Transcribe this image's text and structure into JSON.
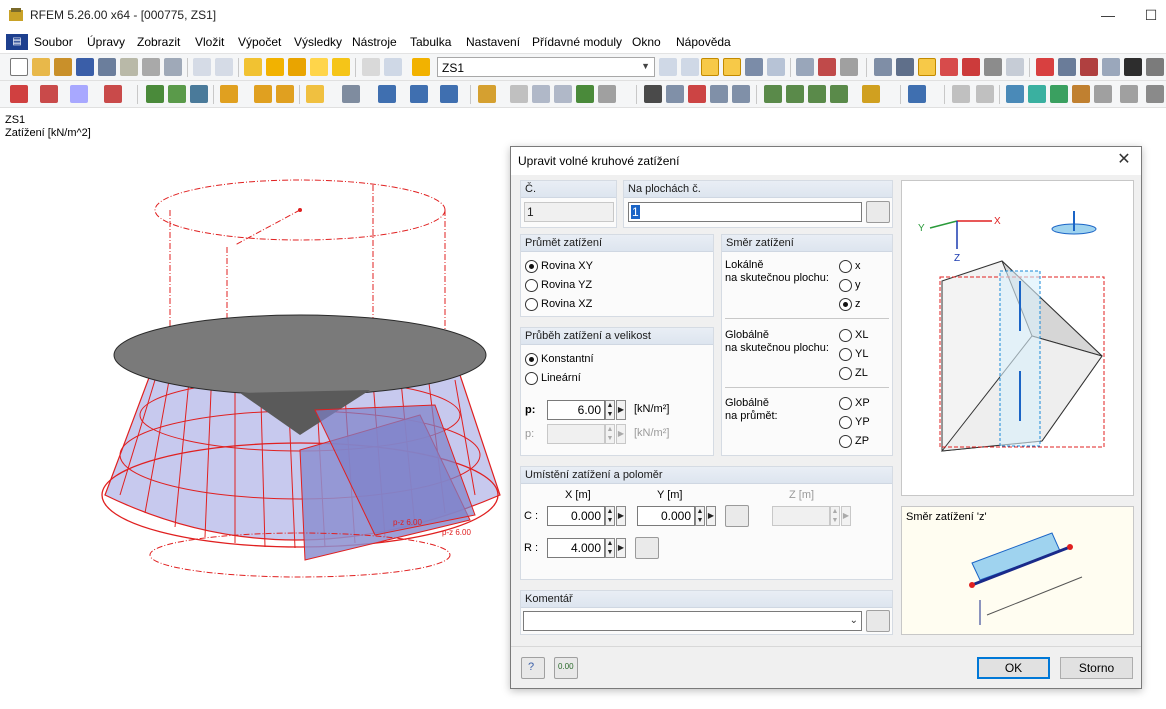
{
  "window": {
    "title": "RFEM 5.26.00 x64 - [000775, ZS1]",
    "min_glyph": "—",
    "max_glyph": "☐"
  },
  "menu": {
    "items": [
      "Soubor",
      "Úpravy",
      "Zobrazit",
      "Vložit",
      "Výpočet",
      "Výsledky",
      "Nástroje",
      "Tabulka",
      "Nastavení",
      "Přídavné moduly",
      "Okno",
      "Nápověda"
    ]
  },
  "toolbar": {
    "load_case": "ZS1"
  },
  "workspace": {
    "load_case_label": "ZS1",
    "load_unit_label": "Zatížení [kN/m^2]",
    "load_label_1": "p-z 6.00",
    "load_label_2": "p-z 6.00"
  },
  "dialog": {
    "title": "Upravit volné kruhové zatížení",
    "close_glyph": "✕",
    "no_header": "Č.",
    "no_value": "1",
    "surfaces_header": "Na plochách č.",
    "surfaces_value": "1",
    "projection": {
      "header": "Průmět zatížení",
      "options": [
        "Rovina XY",
        "Rovina YZ",
        "Rovina XZ"
      ],
      "selected": "Rovina XY"
    },
    "distribution": {
      "header": "Průběh zatížení a velikost",
      "options": [
        "Konstantní",
        "Lineární"
      ],
      "selected": "Konstantní",
      "p_label": "p:",
      "p_value": "6.00",
      "p_unit": "[kN/m²]",
      "p2_label": "p:",
      "p2_value": "",
      "p2_unit": "[kN/m²]"
    },
    "direction": {
      "header": "Směr zatížení",
      "local_label_1": "Lokálně",
      "local_label_2": "na skutečnou plochu:",
      "local_options": [
        "x",
        "y",
        "z"
      ],
      "global_true_label_1": "Globálně",
      "global_true_label_2": "na skutečnou plochu:",
      "global_true_options": [
        "XL",
        "YL",
        "ZL"
      ],
      "global_proj_label_1": "Globálně",
      "global_proj_label_2": "na průmět:",
      "global_proj_options": [
        "XP",
        "YP",
        "ZP"
      ],
      "selected": "z"
    },
    "position": {
      "header": "Umístění zatížení a poloměr",
      "x_label": "X [m]",
      "y_label": "Y [m]",
      "z_label": "Z [m]",
      "c_label": "C :",
      "x_value": "0.000",
      "y_value": "0.000",
      "z_value": "",
      "r_label": "R :",
      "r_value": "4.000"
    },
    "comment": {
      "header": "Komentář",
      "value": ""
    },
    "preview_direction_label": "Směr zatížení 'z'",
    "ok_label": "OK",
    "cancel_label": "Storno"
  }
}
